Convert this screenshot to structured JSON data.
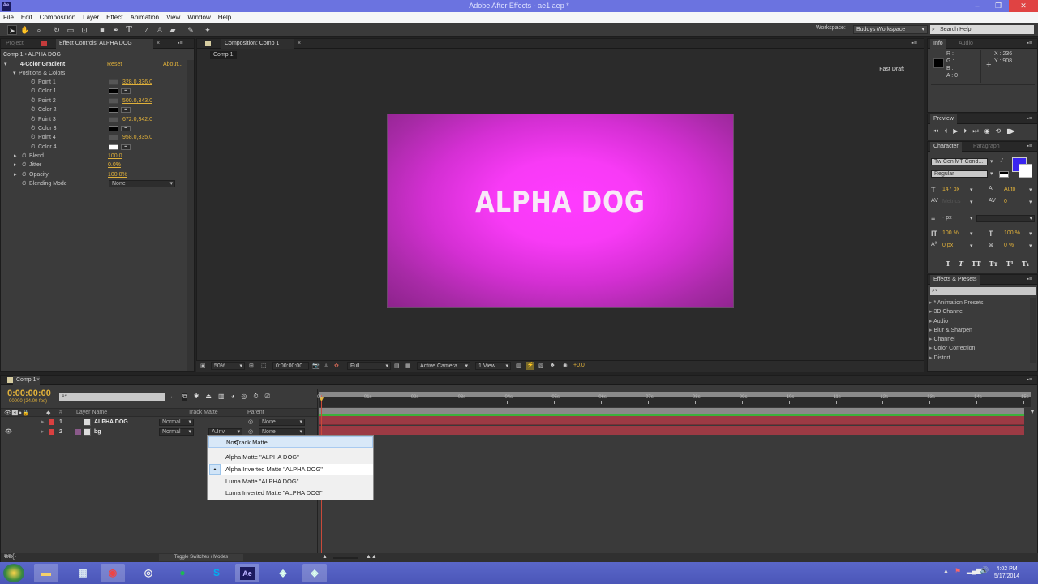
{
  "window": {
    "title": "Adobe After Effects - ae1.aep *",
    "app_icon": "Ae",
    "controls": [
      "minimize",
      "restore",
      "close"
    ]
  },
  "menu": [
    "File",
    "Edit",
    "Composition",
    "Layer",
    "Effect",
    "Animation",
    "View",
    "Window",
    "Help"
  ],
  "toolbar": {
    "tools": [
      "selection-tool",
      "hand-tool",
      "zoom-tool",
      "rotation-tool",
      "camera-tool",
      "pan-behind-tool",
      "rectangle-tool",
      "pen-tool",
      "type-tool",
      "brush-tool",
      "clone-stamp-tool",
      "eraser-tool",
      "roto-brush-tool",
      "puppet-pin-tool"
    ],
    "workspace_label": "Workspace:",
    "workspace_value": "Buddys Workspace",
    "search_placeholder": "Search Help"
  },
  "left_panel": {
    "tabs": [
      "Project",
      "Effect Controls: ALPHA DOG"
    ],
    "breadcrumb": "Comp 1 • ALPHA DOG",
    "effect_name": "4-Color Gradient",
    "reset_label": "Reset",
    "about_label": "About...",
    "group_label": "Positions & Colors",
    "rows": [
      {
        "label": "Point 1",
        "value": "328.0,336.0"
      },
      {
        "label": "Color 1",
        "swatch": "#000000"
      },
      {
        "label": "Point 2",
        "value": "500.0,343.0"
      },
      {
        "label": "Color 2",
        "swatch": "#000000"
      },
      {
        "label": "Point 3",
        "value": "672.0,342.0"
      },
      {
        "label": "Color 3",
        "swatch": "#000000"
      },
      {
        "label": "Point 4",
        "value": "958.0,335.0"
      },
      {
        "label": "Color 4",
        "swatch": "#ffffff"
      }
    ],
    "params": [
      {
        "label": "Blend",
        "value": "100.0"
      },
      {
        "label": "Jitter",
        "value": "0.0%"
      },
      {
        "label": "Opacity",
        "value": "100.0%"
      }
    ],
    "blending_mode_label": "Blending Mode",
    "blending_mode_value": "None"
  },
  "composition": {
    "tab": "Composition: Comp 1",
    "subtab": "Comp 1",
    "fast_draft": "Fast Draft",
    "canvas_text": "ALPHA DOG",
    "viewer_bar": {
      "zoom": "50%",
      "timecode": "0:00:00:00",
      "resolution": "Full",
      "camera": "Active Camera",
      "views": "1 View",
      "exposure": "+0.0"
    }
  },
  "info_panel": {
    "tabs": [
      "Info",
      "Audio"
    ],
    "r": "R :",
    "g": "G :",
    "b": "B :",
    "a": "A : 0",
    "x": "X : 236",
    "y": "Y : 908"
  },
  "preview_panel": {
    "tab": "Preview"
  },
  "character_panel": {
    "tabs": [
      "Character",
      "Paragraph"
    ],
    "font": "Tw Cen MT Cond...",
    "style": "Regular",
    "size": "147 px",
    "leading": "Auto",
    "kerning": "Metrics",
    "tracking": "0",
    "stroke": "- px",
    "vscale": "100 %",
    "hscale": "100 %",
    "baseline": "0 px",
    "tsume": "0 %",
    "fill_color": "#3a25f0"
  },
  "effects_presets": {
    "tab": "Effects & Presets",
    "items": [
      "* Animation Presets",
      "3D Channel",
      "Audio",
      "Blur & Sharpen",
      "Channel",
      "Color Correction",
      "Distort"
    ]
  },
  "timeline": {
    "tab": "Comp 1",
    "timecode": "0:00:00:00",
    "frame_info": "00000 (24.00 fps)",
    "columns": {
      "name": "Layer Name",
      "track_matte": "Track Matte",
      "parent": "Parent",
      "num": "#"
    },
    "layers": [
      {
        "num": "1",
        "name": "ALPHA DOG",
        "mode": "Normal",
        "track_matte": "",
        "parent": "None",
        "label_color": "#d94040"
      },
      {
        "num": "2",
        "name": "bg",
        "mode": "Normal",
        "track_matte": "A.Inv",
        "parent": "None",
        "label_color": "#d94040"
      }
    ],
    "ruler": [
      "0s",
      "01s",
      "02s",
      "03s",
      "04s",
      "05s",
      "06s",
      "07s",
      "08s",
      "09s",
      "10s",
      "11s",
      "12s",
      "13s",
      "14s",
      "15s"
    ],
    "toggle_label": "Toggle Switches / Modes"
  },
  "track_matte_menu": {
    "items": [
      {
        "label": "No Track Matte",
        "hover": true,
        "checked": false
      },
      {
        "label": "Alpha Matte \"ALPHA DOG\"",
        "hover": false,
        "checked": false
      },
      {
        "label": "Alpha Inverted Matte \"ALPHA DOG\"",
        "hover": false,
        "checked": true
      },
      {
        "label": "Luma Matte \"ALPHA DOG\"",
        "hover": false,
        "checked": false
      },
      {
        "label": "Luma Inverted Matte \"ALPHA DOG\"",
        "hover": false,
        "checked": false
      }
    ]
  },
  "taskbar": {
    "apps": [
      "start",
      "file-explorer",
      "calculator",
      "chrome",
      "steam",
      "spotify",
      "skype",
      "after-effects",
      "app-green",
      "app-recording"
    ],
    "ae_label": "Ae",
    "time": "4:02 PM",
    "date": "5/17/2014"
  }
}
